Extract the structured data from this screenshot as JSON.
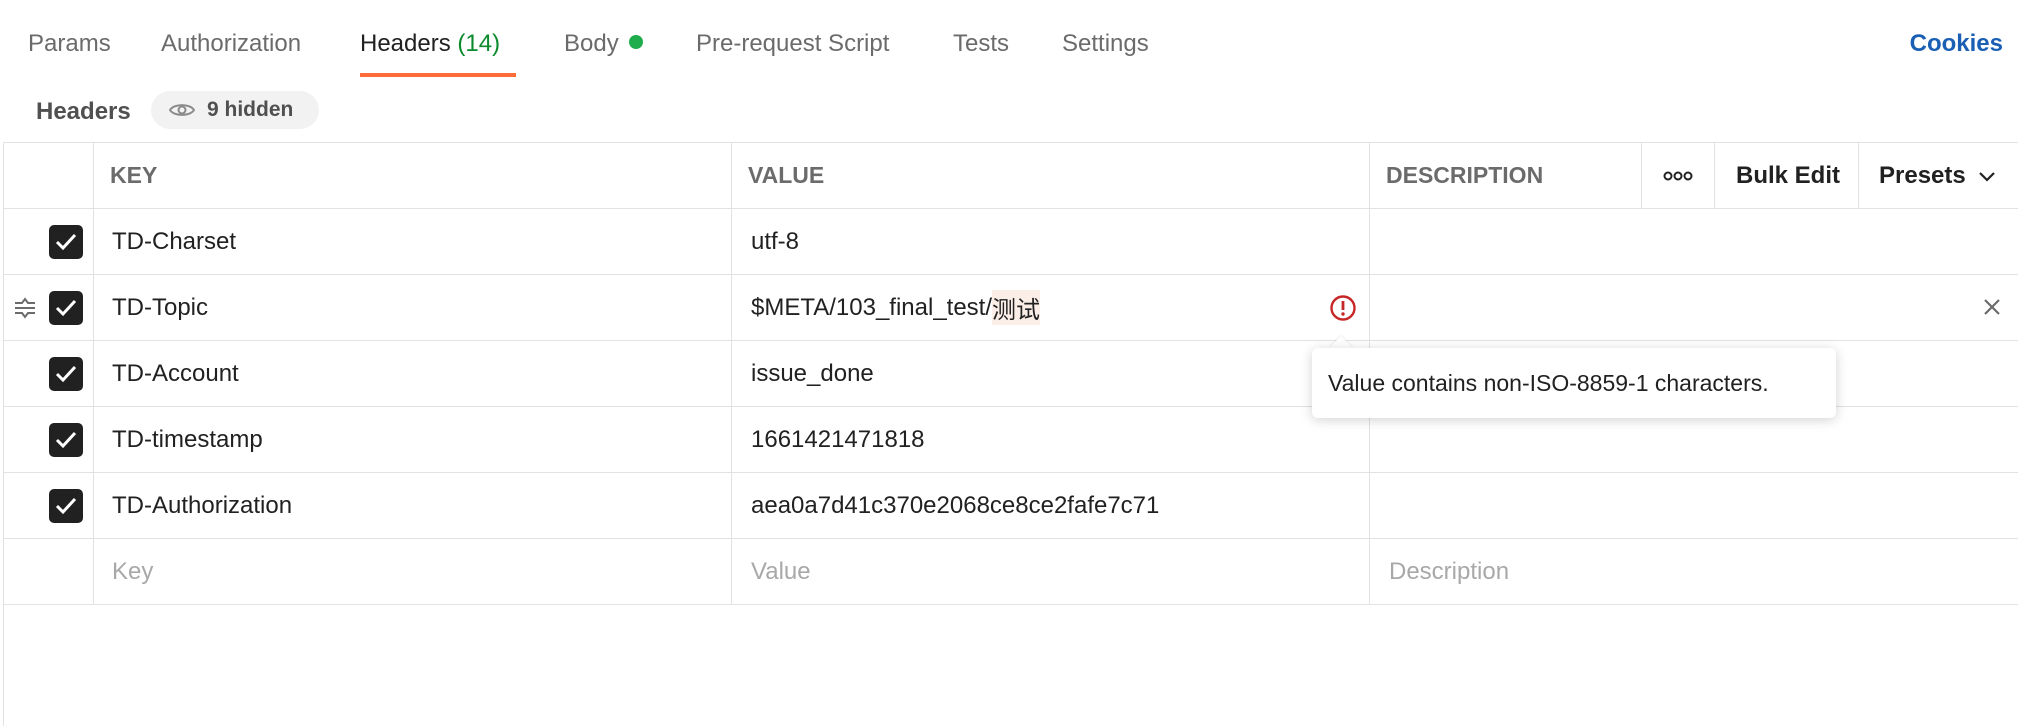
{
  "tabs": [
    {
      "label": "Params"
    },
    {
      "label": "Authorization"
    },
    {
      "label": "Headers",
      "count": "(14)"
    },
    {
      "label": "Body"
    },
    {
      "label": "Pre-request Script"
    },
    {
      "label": "Tests"
    },
    {
      "label": "Settings"
    }
  ],
  "cookies_label": "Cookies",
  "section": {
    "title": "Headers",
    "hidden_label": "9 hidden"
  },
  "table": {
    "headers": {
      "key": "KEY",
      "value": "VALUE",
      "description": "DESCRIPTION",
      "bulk_edit": "Bulk Edit",
      "presets": "Presets"
    },
    "rows": [
      {
        "key": "TD-Charset",
        "value": "utf-8"
      },
      {
        "key": "TD-Topic",
        "value_prefix": "$META/103_final_test/",
        "value_cjk": "测试"
      },
      {
        "key": "TD-Account",
        "value": "issue_done"
      },
      {
        "key": "TD-timestamp",
        "value": "1661421471818"
      },
      {
        "key": "TD-Authorization",
        "value": "aea0a7d41c370e2068ce8ce2fafe7c71"
      }
    ],
    "placeholders": {
      "key": "Key",
      "value": "Value",
      "description": "Description"
    }
  },
  "tooltip": "Value contains non-ISO-8859-1 characters.",
  "colors": {
    "accent": "#ff6c37",
    "count": "#0b8a2d",
    "body_dot": "#1fad4b",
    "link": "#1a5fb4",
    "warning": "#c62828"
  }
}
